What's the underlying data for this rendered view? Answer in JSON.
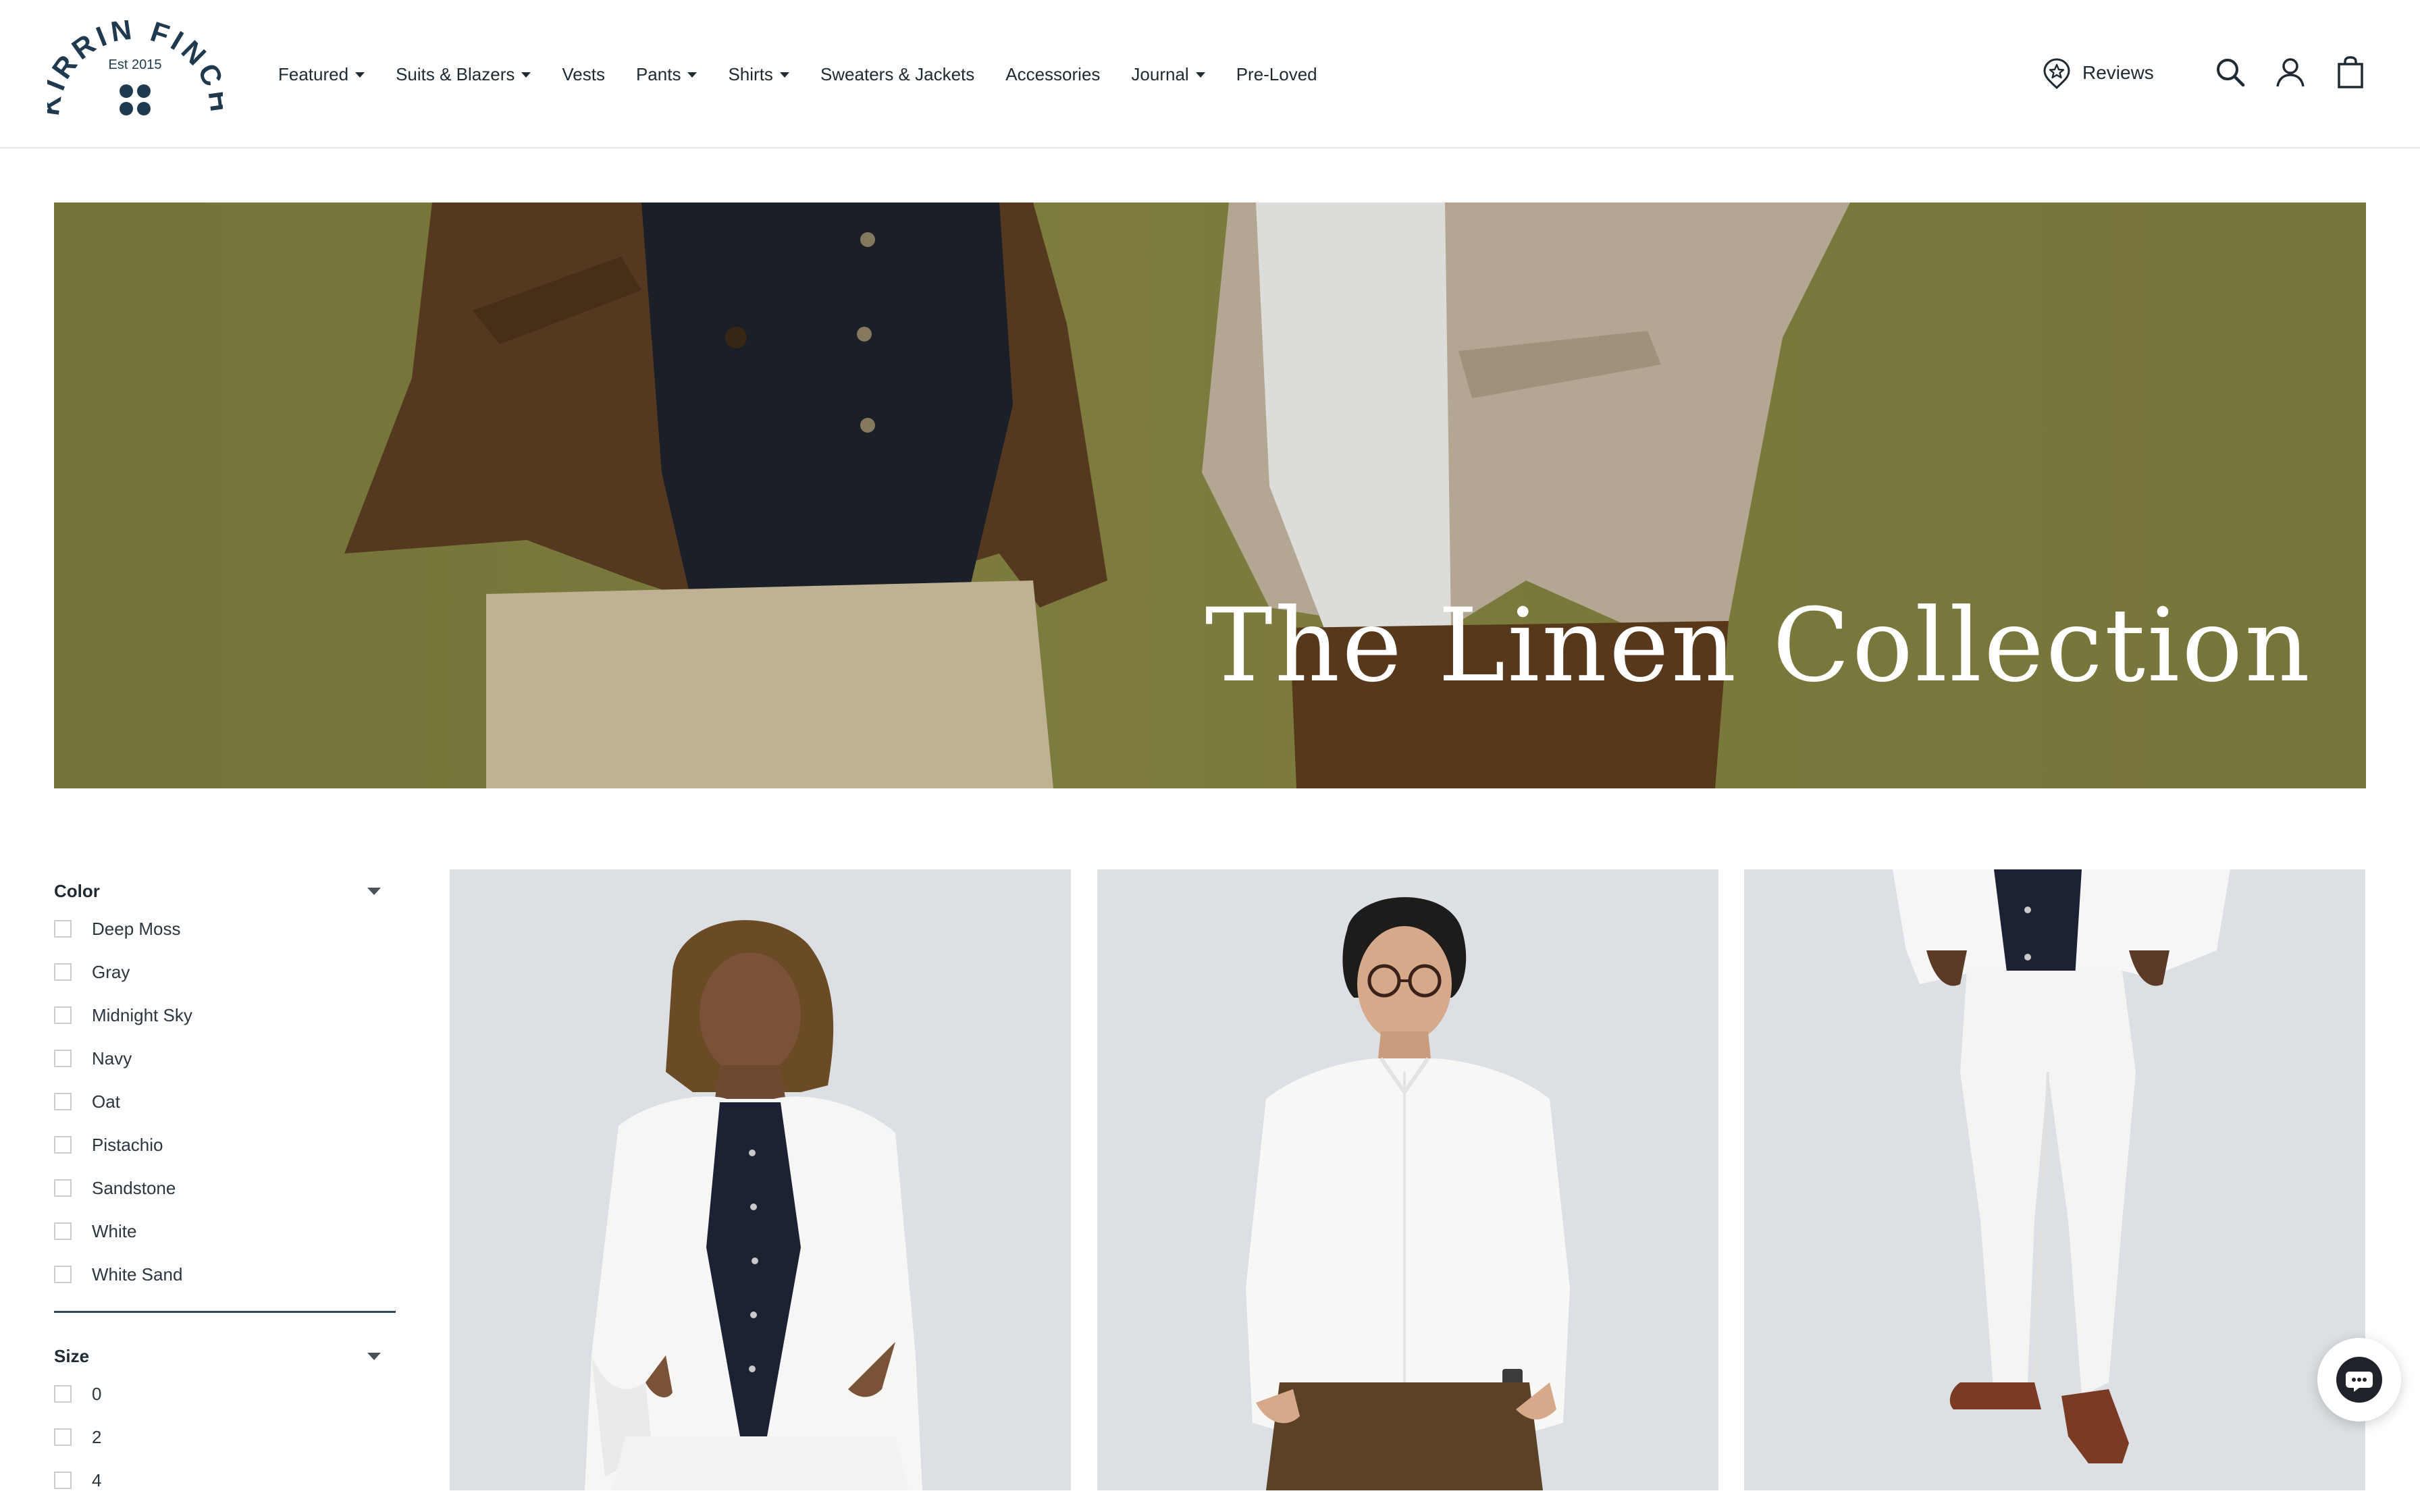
{
  "brand": {
    "name_top": "KIRRIN FINCH",
    "est": "Est 2015",
    "color_navy": "#1f3a4f"
  },
  "nav": {
    "items": [
      {
        "label": "Featured",
        "has_dropdown": true
      },
      {
        "label": "Suits & Blazers",
        "has_dropdown": true
      },
      {
        "label": "Vests",
        "has_dropdown": false
      },
      {
        "label": "Pants",
        "has_dropdown": true
      },
      {
        "label": "Shirts",
        "has_dropdown": true
      },
      {
        "label": "Sweaters & Jackets",
        "has_dropdown": false
      },
      {
        "label": "Accessories",
        "has_dropdown": false
      },
      {
        "label": "Journal",
        "has_dropdown": true
      },
      {
        "label": "Pre-Loved",
        "has_dropdown": false
      }
    ]
  },
  "header": {
    "reviews_label": "Reviews",
    "icons": [
      "reviews-badge-icon",
      "search-icon",
      "account-icon",
      "cart-icon"
    ]
  },
  "hero": {
    "title": "The Linen Collection",
    "background_color": "#838240"
  },
  "filters": {
    "color": {
      "label": "Color",
      "options": [
        "Deep Moss",
        "Gray",
        "Midnight Sky",
        "Navy",
        "Oat",
        "Pistachio",
        "Sandstone",
        "White",
        "White Sand"
      ]
    },
    "size": {
      "label": "Size",
      "options": [
        "0",
        "2",
        "4"
      ]
    }
  },
  "products": [
    {
      "image": "person in white linen blazer over navy shirt"
    },
    {
      "image": "person in white linen button-up shirt with brown pants"
    },
    {
      "image": "white linen pants with brown loafers"
    }
  ],
  "chat": {
    "icon": "chat-bubble-icon"
  }
}
